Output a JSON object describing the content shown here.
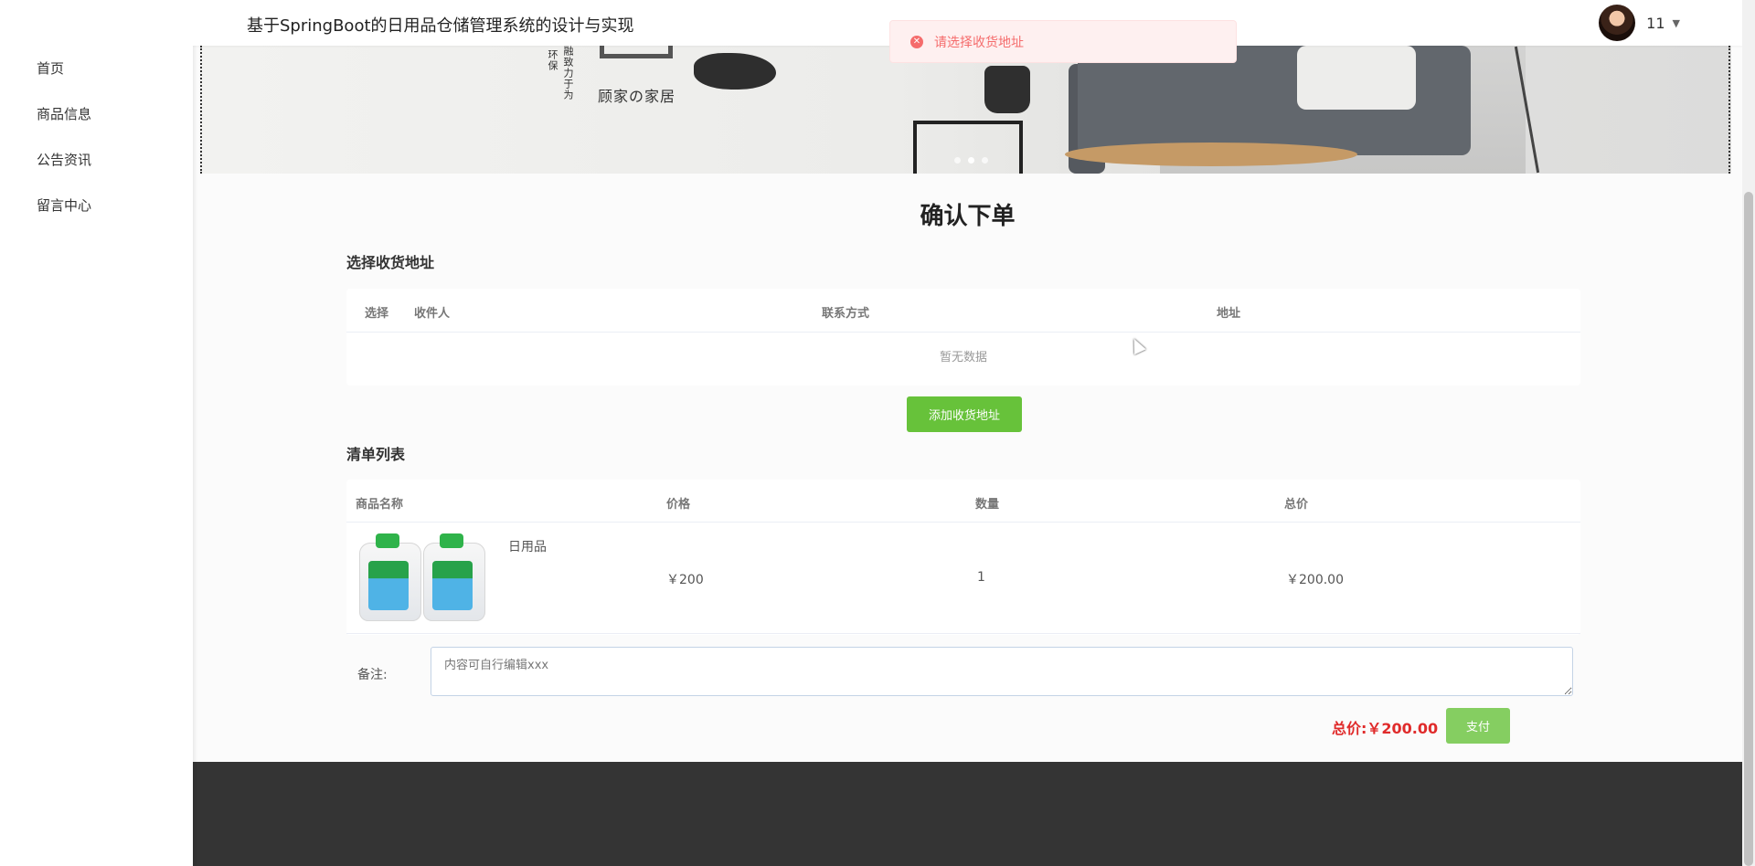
{
  "app_title": "基于SpringBoot的日用品仓储管理系统的设计与实现",
  "sidebar": {
    "items": [
      {
        "label": "首页"
      },
      {
        "label": "商品信息"
      },
      {
        "label": "公告资讯"
      },
      {
        "label": "留言中心"
      }
    ]
  },
  "user": {
    "name": "11",
    "caret": "▼"
  },
  "toast": {
    "icon": "✕",
    "message": "请选择收货地址",
    "type": "error"
  },
  "banner": {
    "caption": "顾家の家居",
    "vertical_text": [
      "环保",
      "融致力于为"
    ],
    "slide_count": 3,
    "active_slide": 2
  },
  "page": {
    "title": "确认下单"
  },
  "address_section": {
    "title": "选择收货地址",
    "columns": [
      "选择",
      "收件人",
      "联系方式",
      "地址"
    ],
    "rows": [],
    "empty_text": "暂无数据",
    "add_button_label": "添加收货地址"
  },
  "order_section": {
    "title": "清单列表",
    "columns": [
      "商品名称",
      "价格",
      "数量",
      "总价"
    ],
    "rows": [
      {
        "name": "日用品",
        "price": "￥200",
        "quantity": "1",
        "total": "￥200.00"
      }
    ]
  },
  "remark": {
    "label": "备注:",
    "value": "内容可自行编辑xxx"
  },
  "summary": {
    "total_label": "总价:",
    "total_value": "￥200.00",
    "pay_button_label": "支付"
  },
  "colors": {
    "accent_green": "#67c23a",
    "error_red": "#f56c6c",
    "total_red": "#e02b2b",
    "footer": "#343434"
  }
}
